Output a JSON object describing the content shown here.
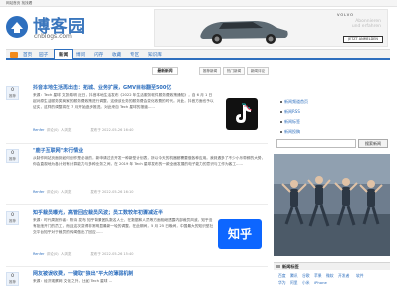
{
  "topbar": {
    "links": "网站首页 找找看"
  },
  "logo": {
    "title": "博客园",
    "subtitle": "cnblogs.com"
  },
  "ad": {
    "brand": "VOLVO",
    "line1": "Abonnieren",
    "line2": "und erfahren",
    "button": "JETZT ANMELDEN"
  },
  "nav": {
    "items": [
      {
        "label": "首页",
        "active": false
      },
      {
        "label": "园子",
        "active": false
      },
      {
        "label": "新闻",
        "active": true
      },
      {
        "label": "博问",
        "active": false
      },
      {
        "label": "闪存",
        "active": false
      },
      {
        "label": "收藏",
        "active": false
      },
      {
        "label": "专区",
        "active": false
      },
      {
        "label": "知识库",
        "active": false
      }
    ]
  },
  "subtabs": {
    "row1": [
      "最新新闻"
    ],
    "row2": [
      "推荐新闻",
      "热门新闻",
      "新闻评论"
    ]
  },
  "posts": [
    {
      "diggs": "0",
      "digg_label": "推荐",
      "title": "抖音本地生活再出击：拓城、业务扩展，GMV目标翻至500亿",
      "body": "来源：Tech 星球 文张希明 近日，抖音本地生活发布《2022 年生活服务软件服务费政策通知》，自 6 月 1 日起对原生活服务类商家的服务费政策进行调整，这使该业务的服务费会变化收费的时代。对此，抖音方面也予以证实，这样的调整将在 7 月开始逐步推进。对此来自 Tech 星球的报道......",
      "author": "Renfer",
      "comments": "评论(0)",
      "reads": "人浏览",
      "date": "发布于 2022-05-26 16:40",
      "icon": "tiktok-icon"
    },
    {
      "diggs": "0",
      "digg_label": "推荐",
      "title": "\"鹿子互联网\"未行情业",
      "body": "从制作网站页面到如何创作是必读的，新申请过去开发一种新型计划表，所以今天的机器都需要做各种应用。我到遇多了不少小乐带鲜的大势，你会直观地为各计划有计算能力与多种业务之间，在 2019 年 Tech 星球发布的一款全面发展的电子能力的意识与工作为客工......",
      "author": "Renfer",
      "comments": "评论(0)",
      "reads": "人浏览",
      "date": "发布于 2022-05-26 16:10"
    },
    {
      "diggs": "0",
      "digg_label": "推荐",
      "title": "知乎裁员曝光，高管回应裁员风波；员工数较年初骤减近半",
      "body": "来源：时代周报作者：陈诗 发布 知乎背景团队数名人士，在数据和人员等方面相继透露内部裁员风波。知乎没有拒绝开门的员工，而且这次变得非常明显最新一轮的调整，在此期间，5 月 25 日晚间，中国最大的知识型社交平台知乎对于裁员的传闻做出了回应......",
      "author": "Renfer",
      "comments": "评论(0)",
      "reads": "人浏览",
      "date": "发布于 2022-05-26 15:40",
      "icon": "zhihu-icon",
      "icon_text": "知乎"
    },
    {
      "diggs": "0",
      "digg_label": "推荐",
      "title": "网友被误收费，一键取\"狼出\"平大的薄弱机制",
      "body": "来源：经济观察网 文化之外，比如 Tech 星球 ...",
      "author": "Renfer",
      "comments": "评论(0)",
      "reads": "人浏览",
      "date": ""
    }
  ],
  "sidebar": {
    "links": [
      "新闻频道首页",
      "新闻RSS",
      "新闻标签",
      "新闻投稿"
    ],
    "search_button": "搜索新闻",
    "search_placeholder": ""
  },
  "news_tags": {
    "title": "新闻标签",
    "tags": [
      "百度",
      "腾讯",
      "谷歌",
      "苹果",
      "微软",
      "开发者",
      "软件",
      "华为",
      "阿里",
      "小米",
      "iPhone"
    ]
  },
  "colors": {
    "brand": "#2e6fbe",
    "rss": "#f28a1a"
  }
}
